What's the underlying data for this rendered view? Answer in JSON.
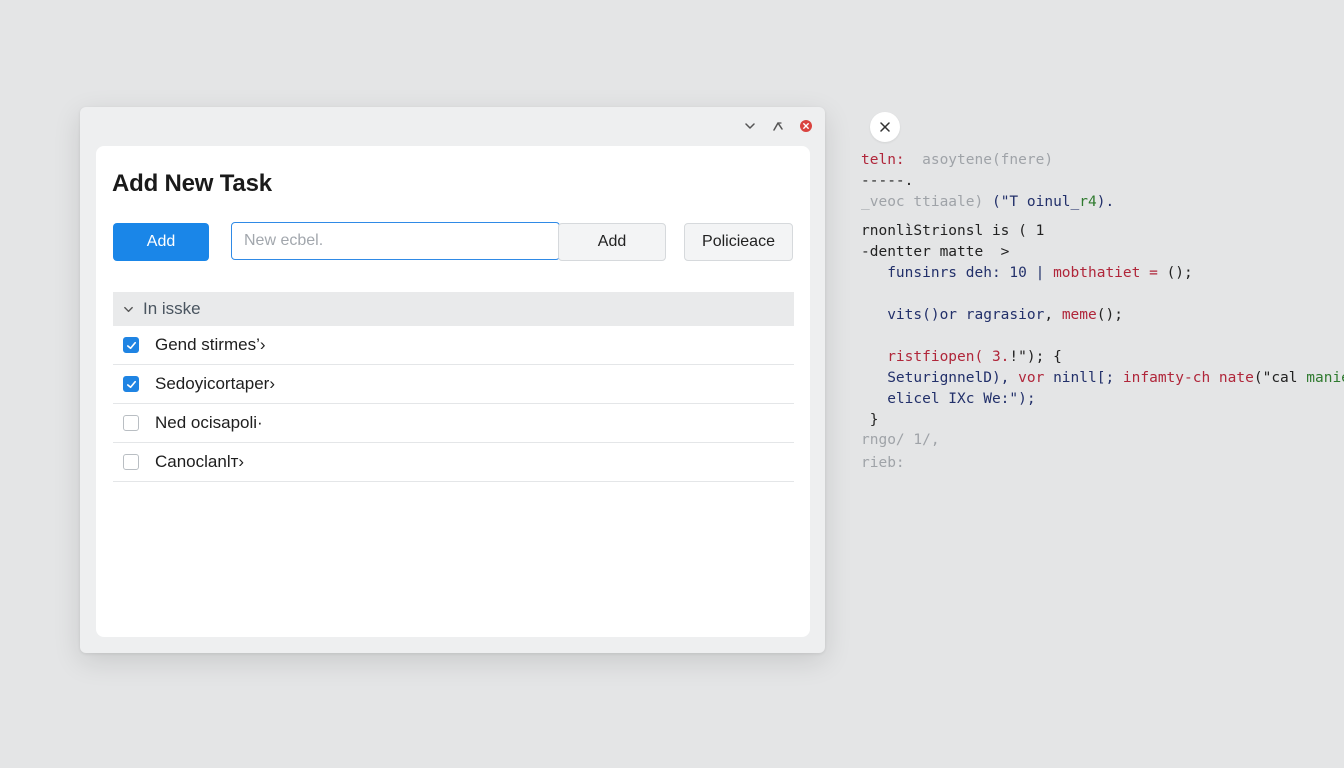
{
  "window": {
    "controls": [
      {
        "name": "collapse",
        "icon": "chevron-down-icon"
      },
      {
        "name": "expand",
        "icon": "arrow-up-right-icon"
      },
      {
        "name": "close",
        "icon": "close-circle-icon",
        "color": "#d9433f"
      }
    ]
  },
  "form": {
    "title": "Add New Task",
    "add_label": "Add",
    "input_value": "",
    "input_placeholder": "New ecbel.",
    "add2_label": "Add",
    "policy_label": "Policieace"
  },
  "group": {
    "label": "In isske",
    "tasks": [
      {
        "label": "Gend stirmes’›",
        "checked": true
      },
      {
        "label": "Sedoyicortaper›",
        "checked": true
      },
      {
        "label": "Ned ocisapoli·",
        "checked": false
      },
      {
        "label": "Canoclanӏт›",
        "checked": false
      }
    ]
  },
  "code_lines": [
    {
      "parts": [
        {
          "t": "teln:  ",
          "c": "red"
        },
        {
          "t": "asoytene(fnere)",
          "c": "faint"
        }
      ]
    },
    {
      "parts": [
        {
          "t": "-----.",
          "c": "dark"
        }
      ]
    },
    {
      "parts": [
        {
          "t": "_veoc",
          "c": "faint"
        },
        {
          "t": " ",
          "c": "dark"
        },
        {
          "t": "ttiaale)",
          "c": "faint"
        },
        {
          "t": " (\"T oinul_",
          "c": "navy"
        },
        {
          "t": "r4",
          "c": "green"
        },
        {
          "t": ").",
          "c": "navy"
        }
      ]
    },
    {
      "parts": [
        {
          "t": "rnonlìStrionsl is ( 1",
          "c": "dark"
        }
      ]
    },
    {
      "parts": [
        {
          "t": "-dentter matte  >",
          "c": "dark"
        }
      ]
    },
    {
      "parts": [
        {
          "t": "   funsinrs deh: 10 | ",
          "c": "navy"
        },
        {
          "t": "mobthatiet = ",
          "c": "red"
        },
        {
          "t": "();",
          "c": "dark"
        }
      ]
    },
    {
      "parts": [
        {
          "t": "",
          "c": "dark"
        }
      ]
    },
    {
      "parts": [
        {
          "t": "   vits()or ",
          "c": "navy"
        },
        {
          "t": "ragrasior",
          "c": "navy"
        },
        {
          "t": ", ",
          "c": "dark"
        },
        {
          "t": "meme",
          "c": "red"
        },
        {
          "t": "();",
          "c": "dark"
        }
      ]
    },
    {
      "parts": [
        {
          "t": "",
          "c": "dark"
        }
      ]
    },
    {
      "parts": [
        {
          "t": "   ristfiopen( ",
          "c": "red"
        },
        {
          "t": "3.",
          "c": "red"
        },
        {
          "t": "!\"); {",
          "c": "dark"
        }
      ]
    },
    {
      "parts": [
        {
          "t": "   SeturignnelD), ",
          "c": "navy"
        },
        {
          "t": "vor ",
          "c": "red"
        },
        {
          "t": "ninll[; ",
          "c": "navy"
        },
        {
          "t": "infamty-ch nate",
          "c": "red"
        },
        {
          "t": "(\"cal ",
          "c": "dark"
        },
        {
          "t": "manied",
          "c": "green"
        }
      ]
    },
    {
      "parts": [
        {
          "t": "   elicel IXc We:\");",
          "c": "navy"
        }
      ]
    },
    {
      "parts": [
        {
          "t": " }",
          "c": "dark"
        }
      ]
    },
    {
      "parts": [
        {
          "t": "rngo/ 1/,",
          "c": "faint"
        }
      ]
    },
    {
      "parts": [
        {
          "t": "rieb:",
          "c": "faint"
        }
      ]
    }
  ],
  "colors": {
    "accent": "#1a86e8",
    "background": "#e4e5e6"
  }
}
